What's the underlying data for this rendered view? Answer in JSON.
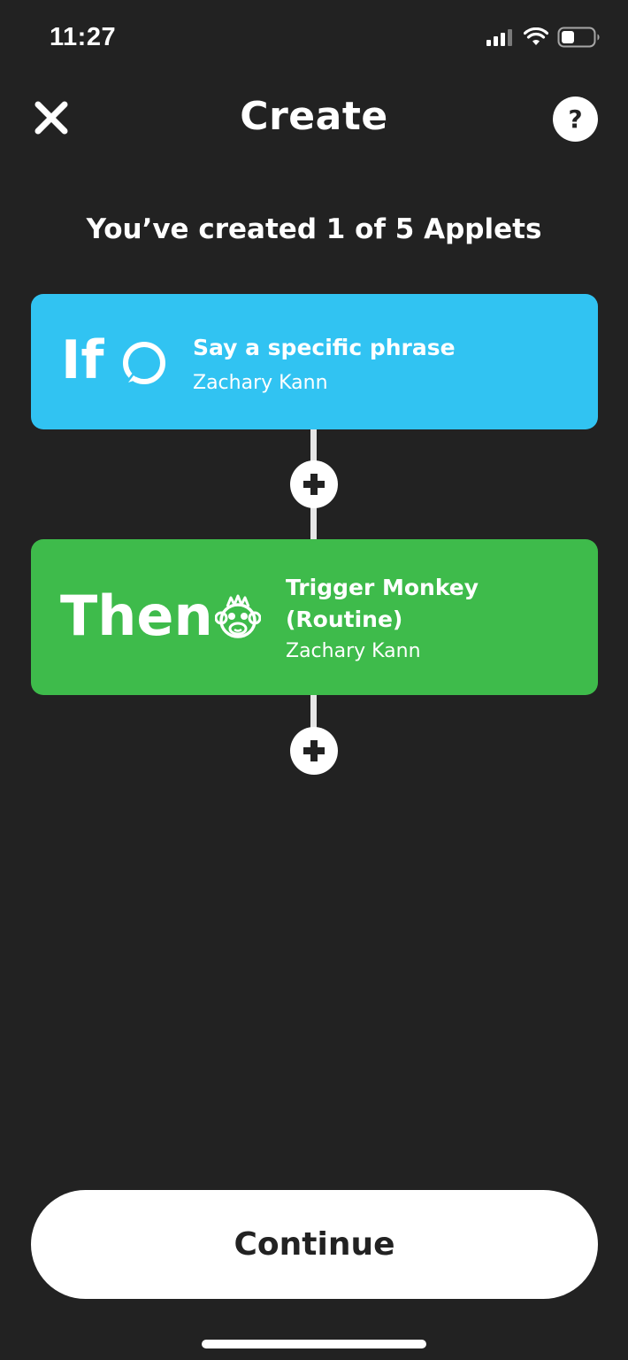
{
  "status_bar": {
    "time": "11:27",
    "icons": [
      "signal-icon",
      "wifi-icon",
      "battery-icon"
    ]
  },
  "header": {
    "title": "Create",
    "close_icon": "close-icon",
    "help_label": "?"
  },
  "applet_count_text": "You’ve created 1 of 5 Applets",
  "trigger_card": {
    "word": "If",
    "icon": "alexa-icon",
    "action": "Say a specific phrase",
    "account": "Zachary Kann",
    "color": "#31c3f2"
  },
  "action_card": {
    "word": "Then",
    "icon": "monkey-icon",
    "action": "Trigger Monkey (Routine)",
    "account": "Zachary Kann",
    "color": "#3ebb4b"
  },
  "add_buttons": [
    "plus-icon",
    "plus-icon"
  ],
  "continue_label": "Continue",
  "colors": {
    "background": "#222222",
    "text": "#ffffff"
  }
}
